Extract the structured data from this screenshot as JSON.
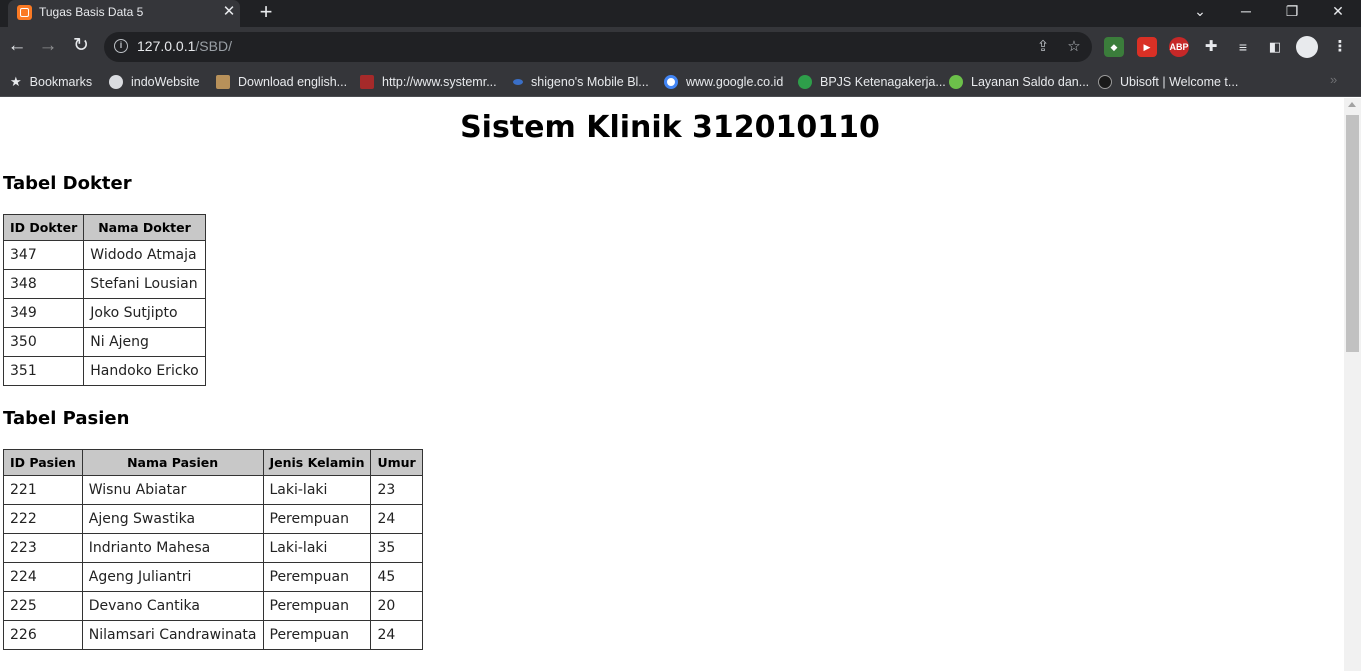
{
  "browser": {
    "tab_title": "Tugas Basis Data 5",
    "url_host": "127.0.0.1",
    "url_path": "/SBD/",
    "bookmarks": [
      {
        "label": "Bookmarks",
        "icon": "star-icon"
      },
      {
        "label": "indoWebsite",
        "icon": "globe-icon"
      },
      {
        "label": "Download english...",
        "icon": "figure-icon"
      },
      {
        "label": "http://www.systemr...",
        "icon": "site-icon"
      },
      {
        "label": "shigeno's Mobile Bl...",
        "icon": "dot-icon"
      },
      {
        "label": "www.google.co.id",
        "icon": "google-icon"
      },
      {
        "label": "BPJS Ketenagakerja...",
        "icon": "bpjs-icon"
      },
      {
        "label": "Layanan Saldo dan...",
        "icon": "saldo-icon"
      },
      {
        "label": "Ubisoft | Welcome t...",
        "icon": "ubisoft-icon"
      }
    ],
    "colors": {
      "tabstrip": "#202124",
      "toolbar": "#35363a",
      "favicon": "#fb7a24"
    }
  },
  "page": {
    "title": "Sistem Klinik 312010110",
    "dokter": {
      "heading": "Tabel Dokter",
      "columns": [
        "ID Dokter",
        "Nama Dokter"
      ],
      "rows": [
        [
          "347",
          "Widodo Atmaja"
        ],
        [
          "348",
          "Stefani Lousian"
        ],
        [
          "349",
          "Joko Sutjipto"
        ],
        [
          "350",
          "Ni Ajeng"
        ],
        [
          "351",
          "Handoko Ericko"
        ]
      ]
    },
    "pasien": {
      "heading": "Tabel Pasien",
      "columns": [
        "ID Pasien",
        "Nama Pasien",
        "Jenis Kelamin",
        "Umur"
      ],
      "rows": [
        [
          "221",
          "Wisnu Abiatar",
          "Laki-laki",
          "23"
        ],
        [
          "222",
          "Ajeng Swastika",
          "Perempuan",
          "24"
        ],
        [
          "223",
          "Indrianto Mahesa",
          "Laki-laki",
          "35"
        ],
        [
          "224",
          "Ageng Juliantri",
          "Perempuan",
          "45"
        ],
        [
          "225",
          "Devano Cantika",
          "Perempuan",
          "20"
        ],
        [
          "226",
          "Nilamsari Candrawinata",
          "Perempuan",
          "24"
        ]
      ]
    }
  }
}
